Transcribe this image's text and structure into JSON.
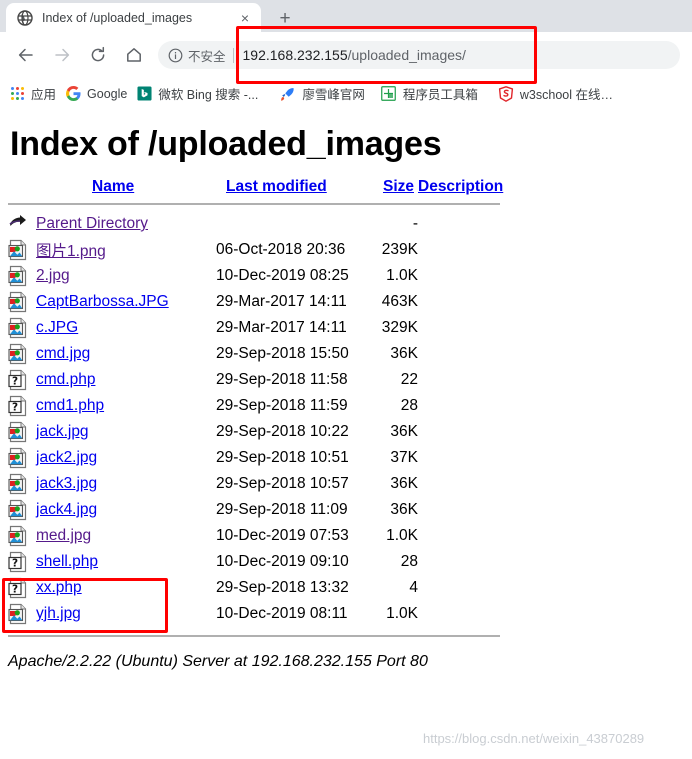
{
  "browser": {
    "tab": {
      "title": "Index of /uploaded_images",
      "favicon_name": "globe-icon",
      "close_label": "×"
    },
    "new_tab_label": "+",
    "nav": {
      "back_label": "←",
      "forward_label": "→",
      "reload_label": "↻",
      "home_label": "⌂"
    },
    "omnibox": {
      "security_label": "不安全",
      "url_host": "192.168.232.155",
      "url_path": "/uploaded_images/",
      "full_url": "192.168.232.155/uploaded_images/"
    },
    "bookmarks": [
      {
        "label": "应用",
        "icon": "apps-grid-icon"
      },
      {
        "label": "Google",
        "icon": "google-g-icon"
      },
      {
        "label": "微软 Bing 搜索 -...",
        "icon": "bing-b-icon"
      },
      {
        "label": "廖雪峰官网",
        "icon": "rocket-icon"
      },
      {
        "label": "程序员工具箱",
        "icon": "toolbox-icon"
      },
      {
        "label": "w3school 在线…",
        "icon": "w3school-icon"
      }
    ]
  },
  "page": {
    "heading": "Index of /uploaded_images",
    "columns": {
      "icon": "",
      "name": "Name",
      "last_modified": "Last modified",
      "size": "Size",
      "description": "Description"
    },
    "rows": [
      {
        "icon": "back-arrow-icon",
        "name": "Parent Directory",
        "visited": true,
        "modified": "",
        "size": "-",
        "description": ""
      },
      {
        "icon": "image-file-icon",
        "name": "图片1.png",
        "visited": true,
        "modified": "06-Oct-2018 20:36",
        "size": "239K",
        "description": ""
      },
      {
        "icon": "image-file-icon",
        "name": "2.jpg",
        "visited": true,
        "modified": "10-Dec-2019 08:25",
        "size": "1.0K",
        "description": ""
      },
      {
        "icon": "image-file-icon",
        "name": "CaptBarbossa.JPG",
        "visited": false,
        "modified": "29-Mar-2017 14:11",
        "size": "463K",
        "description": ""
      },
      {
        "icon": "image-file-icon",
        "name": "c.JPG",
        "visited": false,
        "modified": "29-Mar-2017 14:11",
        "size": "329K",
        "description": ""
      },
      {
        "icon": "image-file-icon",
        "name": "cmd.jpg",
        "visited": false,
        "modified": "29-Sep-2018 15:50",
        "size": "36K",
        "description": ""
      },
      {
        "icon": "unknown-file-icon",
        "name": "cmd.php",
        "visited": false,
        "modified": "29-Sep-2018 11:58",
        "size": "22",
        "description": ""
      },
      {
        "icon": "unknown-file-icon",
        "name": "cmd1.php",
        "visited": false,
        "modified": "29-Sep-2018 11:59",
        "size": "28",
        "description": ""
      },
      {
        "icon": "image-file-icon",
        "name": "jack.jpg",
        "visited": false,
        "modified": "29-Sep-2018 10:22",
        "size": "36K",
        "description": ""
      },
      {
        "icon": "image-file-icon",
        "name": "jack2.jpg",
        "visited": false,
        "modified": "29-Sep-2018 10:51",
        "size": "37K",
        "description": ""
      },
      {
        "icon": "image-file-icon",
        "name": "jack3.jpg",
        "visited": false,
        "modified": "29-Sep-2018 10:57",
        "size": "36K",
        "description": ""
      },
      {
        "icon": "image-file-icon",
        "name": "jack4.jpg",
        "visited": false,
        "modified": "29-Sep-2018 11:09",
        "size": "36K",
        "description": ""
      },
      {
        "icon": "image-file-icon",
        "name": "med.jpg",
        "visited": true,
        "modified": "10-Dec-2019 07:53",
        "size": "1.0K",
        "description": ""
      },
      {
        "icon": "unknown-file-icon",
        "name": "shell.php",
        "visited": false,
        "modified": "10-Dec-2019 09:10",
        "size": "28",
        "description": ""
      },
      {
        "icon": "unknown-file-icon",
        "name": "xx.php",
        "visited": false,
        "modified": "29-Sep-2018 13:32",
        "size": "4",
        "description": ""
      },
      {
        "icon": "image-file-icon",
        "name": "yjh.jpg",
        "visited": false,
        "modified": "10-Dec-2019 08:11",
        "size": "1.0K",
        "description": ""
      }
    ],
    "server_signature": "Apache/2.2.22 (Ubuntu) Server at 192.168.232.155 Port 80"
  },
  "annotations": {
    "url_box_color": "#ff0000",
    "files_box_color": "#ff0000"
  },
  "watermark": "https://blog.csdn.net/weixin_43870289"
}
